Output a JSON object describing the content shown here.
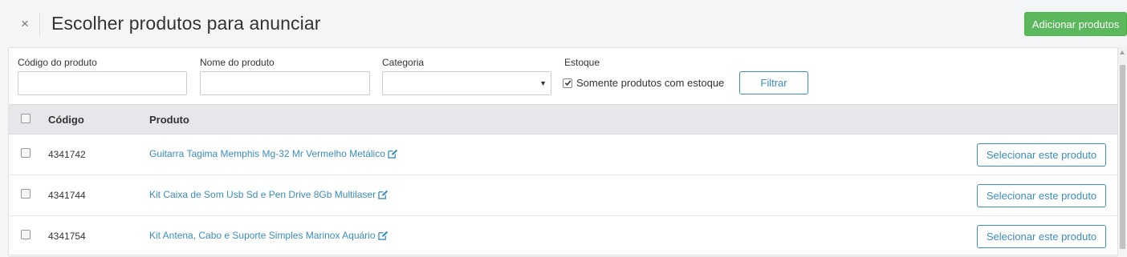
{
  "header": {
    "close_glyph": "×",
    "title": "Escolher produtos para anunciar",
    "add_button": "Adicionar produtos"
  },
  "filters": {
    "code_label": "Código do produto",
    "code_value": "",
    "name_label": "Nome do produto",
    "name_value": "",
    "category_label": "Categoria",
    "category_value": "",
    "stock_label": "Estoque",
    "stock_checkbox_label": "Somente produtos com estoque",
    "stock_checked": true,
    "filter_button": "Filtrar"
  },
  "table": {
    "columns": {
      "code": "Código",
      "product": "Produto"
    },
    "rows": [
      {
        "code": "4341742",
        "product": "Guitarra Tagima Memphis Mg-32 Mr Vermelho Metálico",
        "action": "Selecionar este produto"
      },
      {
        "code": "4341744",
        "product": "Kit Caixa de Som Usb Sd e Pen Drive 8Gb Multilaser",
        "action": "Selecionar este produto"
      },
      {
        "code": "4341754",
        "product": "Kit Antena, Cabo e Suporte Simples Marinox Aquário",
        "action": "Selecionar este produto"
      }
    ]
  },
  "colors": {
    "accent": "#3c8dbc",
    "success": "#5cb85c",
    "header_bg": "#e5e7ea"
  }
}
